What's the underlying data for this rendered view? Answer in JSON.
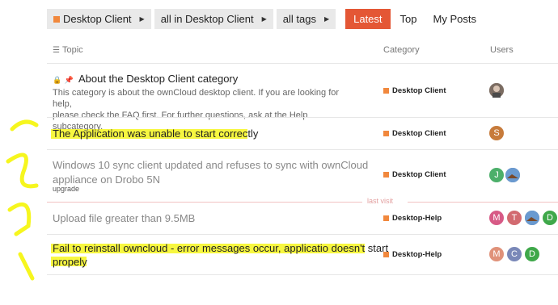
{
  "nav": {
    "category": "Desktop Client",
    "subcategory": "all in Desktop Client",
    "tags": "all tags",
    "latest": "Latest",
    "top": "Top",
    "my_posts": "My Posts"
  },
  "columns": {
    "topic": "Topic",
    "category": "Category",
    "users": "Users"
  },
  "colors": {
    "accent": "#e45735",
    "category": "#f1883d",
    "highlight": "#f6f61e"
  },
  "last_visit": "last visit",
  "topics": [
    {
      "title": "About the Desktop Client category",
      "excerpt_line1": "This category is about the ownCloud desktop client. If you are looking for help,",
      "excerpt_line2": "please check the FAQ first. For further questions, ask at the Help subcategory.",
      "category": "Desktop Client",
      "icons": [
        "lock-icon",
        "pin-icon"
      ]
    },
    {
      "title": "The Application was unable to start correctly",
      "category": "Desktop Client",
      "users": [
        "S"
      ]
    },
    {
      "title_line1": "Windows 10 sync client updated and refuses to sync with ownCloud",
      "title_line2": "appliance on Drobo 5N",
      "tag": "upgrade",
      "category": "Desktop Client",
      "users": [
        "J"
      ]
    },
    {
      "title": "Upload file greater than 9.5MB",
      "category": "Desktop-Help",
      "users": [
        "M",
        "T",
        "D"
      ]
    },
    {
      "title_line1": "Fail to reinstall owncloud - error messages occur, applicatio doesn't start",
      "title_line2": "propely",
      "category": "Desktop-Help",
      "users": [
        "M",
        "C",
        "D"
      ]
    }
  ]
}
